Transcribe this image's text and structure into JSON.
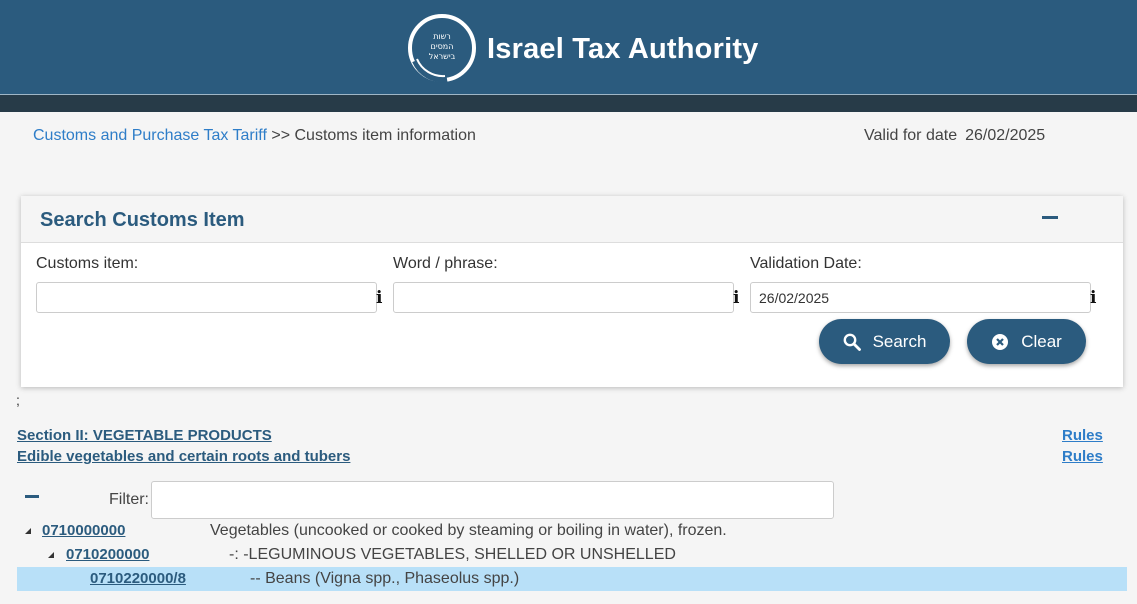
{
  "header": {
    "title": "Israel Tax Authority",
    "logo_text": "רשות המסים בישראל",
    "colors": {
      "header_bg": "#2b5b7e",
      "strip_bg": "#273b48",
      "link": "#2e7dc8"
    }
  },
  "breadcrumb": {
    "link": "Customs and Purchase Tax Tariff",
    "current": ">> Customs item information"
  },
  "valid_date": {
    "label": "Valid for date",
    "value": "26/02/2025"
  },
  "search": {
    "title": "Search Customs Item",
    "collapse_icon": "minus-icon",
    "customs_item_label": "Customs item:",
    "customs_item_value": "",
    "word_label": "Word / phrase:",
    "word_value": "",
    "validation_label": "Validation Date:",
    "validation_value": "26/02/2025",
    "info_icon": "i",
    "search_button": "Search",
    "clear_button": "Clear"
  },
  "stray_char": ";",
  "section": {
    "section_title": "Section II: VEGETABLE PRODUCTS",
    "chapter_title": "Edible vegetables and certain roots and tubers",
    "rules_1": "Rules",
    "rules_2": "Rules"
  },
  "tree": {
    "filter_label": "Filter:",
    "filter_value": "",
    "rows": [
      {
        "code": "0710000000",
        "description": "Vegetables (uncooked or cooked by steaming or boiling in water), frozen."
      },
      {
        "code": "0710200000",
        "description": "-: -LEGUMINOUS VEGETABLES, SHELLED OR UNSHELLED"
      },
      {
        "code": "0710220000/8",
        "description": "-- Beans (Vigna spp., Phaseolus spp.)"
      }
    ]
  }
}
